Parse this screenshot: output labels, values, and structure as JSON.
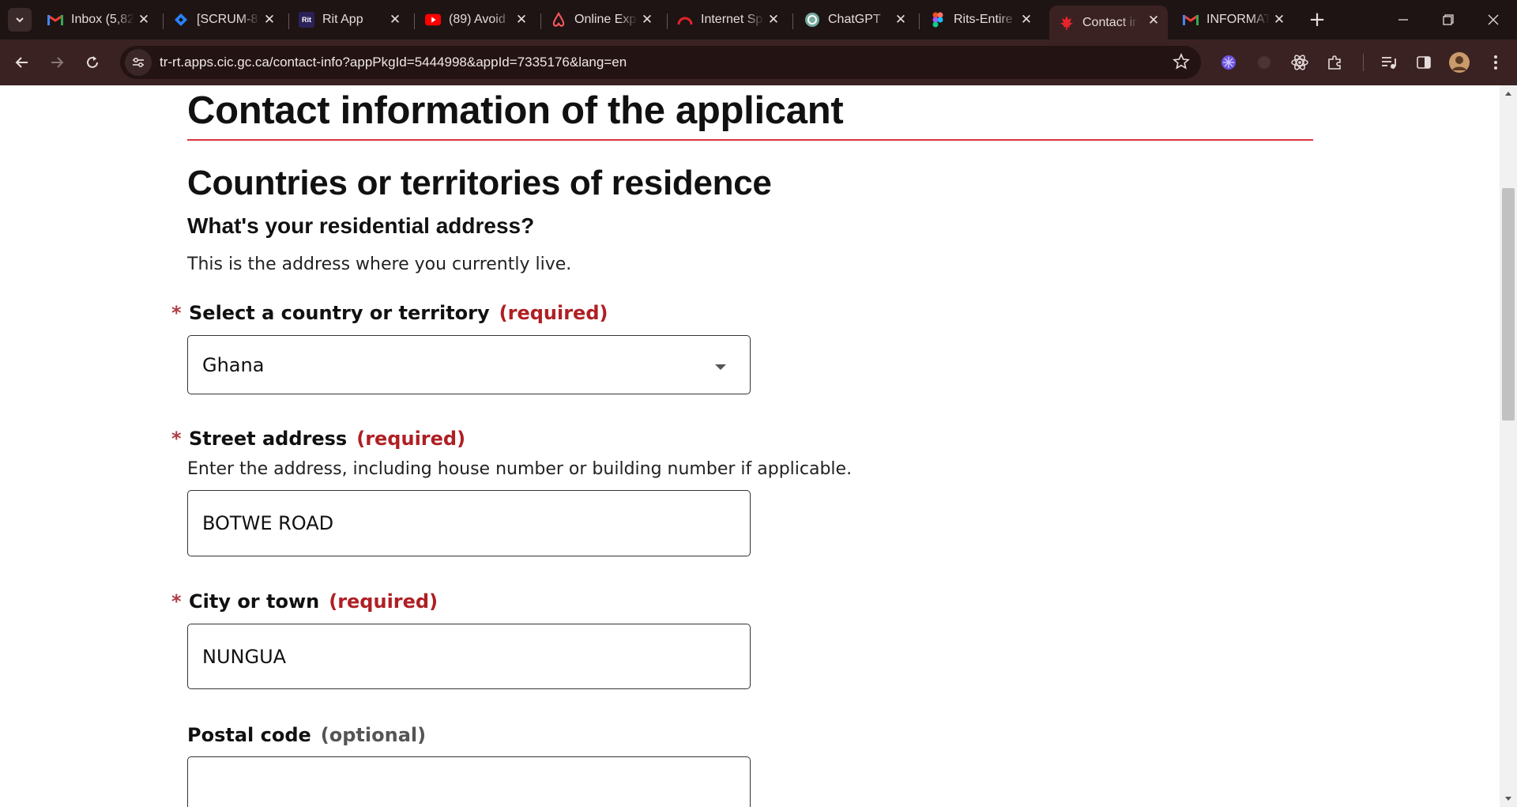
{
  "browser": {
    "tabs": [
      {
        "title": "Inbox (5,82",
        "icon": "gmail-icon"
      },
      {
        "title": "[SCRUM-8",
        "icon": "jira-icon"
      },
      {
        "title": "Rit App",
        "icon": "rit-app-icon",
        "icon_text": "Rit"
      },
      {
        "title": "(89) Avoid",
        "icon": "youtube-icon"
      },
      {
        "title": "Online Exp",
        "icon": "airbnb-icon"
      },
      {
        "title": "Internet Sp",
        "icon": "speedtest-icon"
      },
      {
        "title": "ChatGPT",
        "icon": "chatgpt-icon"
      },
      {
        "title": "Rits-Entire",
        "icon": "figma-icon"
      },
      {
        "title": "Contact in",
        "icon": "maple-leaf-icon",
        "active": true
      },
      {
        "title": "INFORMAT",
        "icon": "gmail-icon"
      }
    ],
    "url": "tr-rt.apps.cic.gc.ca/contact-info?appPkgId=5444998&appId=7335176&lang=en",
    "colors": {
      "chrome_bg": "#1f1414",
      "toolbar_bg": "#3b2222",
      "omnibox_bg": "#231313"
    }
  },
  "page": {
    "title": "Contact information of the applicant",
    "section_title": "Countries or territories of residence",
    "question": "What's your residential address?",
    "lead": "This is the address where you currently live.",
    "fields": {
      "country": {
        "asterisk": "*",
        "label": "Select a country or territory",
        "status": "(required)",
        "value": "Ghana"
      },
      "street": {
        "asterisk": "*",
        "label": "Street address",
        "status": "(required)",
        "hint": "Enter the address, including house number or building number if applicable.",
        "value": "BOTWE ROAD"
      },
      "city": {
        "asterisk": "*",
        "label": "City or town",
        "status": "(required)",
        "value": "NUNGUA"
      },
      "postal": {
        "label": "Postal code",
        "status": "(optional)",
        "value": ""
      }
    },
    "colors": {
      "rule": "#d9363e",
      "required": "#af1f24",
      "asterisk": "#af3c43"
    }
  }
}
